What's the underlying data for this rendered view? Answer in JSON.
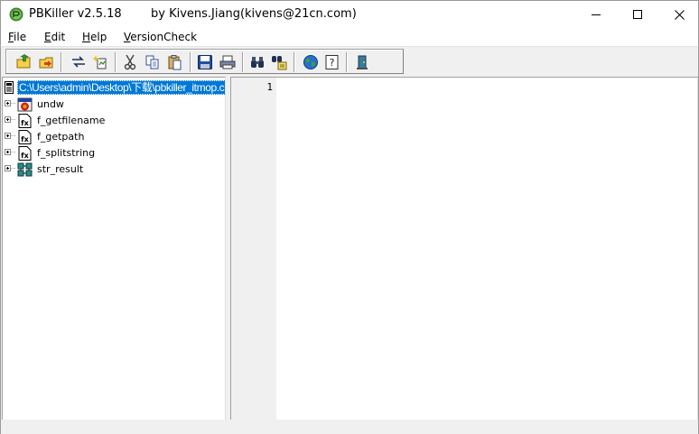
{
  "window": {
    "title": "PBKiller v2.5.18",
    "byline": "by Kivens.Jiang(kivens@21cn.com)"
  },
  "menu": [
    {
      "label": "File",
      "accel": "F",
      "rest": "ile"
    },
    {
      "label": "Edit",
      "accel": "E",
      "rest": "dit"
    },
    {
      "label": "Help",
      "accel": "H",
      "rest": "elp"
    },
    {
      "label": "VersionCheck",
      "accel": "V",
      "rest": "ersionCheck"
    }
  ],
  "tree": {
    "root_path": "C:\\Users\\admin\\Desktop\\下载\\pbkiller_itmop.c",
    "items": [
      {
        "label": "undw",
        "icon": "window-object-icon"
      },
      {
        "label": "f_getfilename",
        "icon": "function-icon"
      },
      {
        "label": "f_getpath",
        "icon": "function-icon"
      },
      {
        "label": "f_splitstring",
        "icon": "function-icon"
      },
      {
        "label": "str_result",
        "icon": "structure-icon"
      }
    ]
  },
  "editor": {
    "line_numbers": [
      "1"
    ]
  },
  "colors": {
    "selection": "#0078d7",
    "toolbar_bg": "#f0f0f0"
  }
}
